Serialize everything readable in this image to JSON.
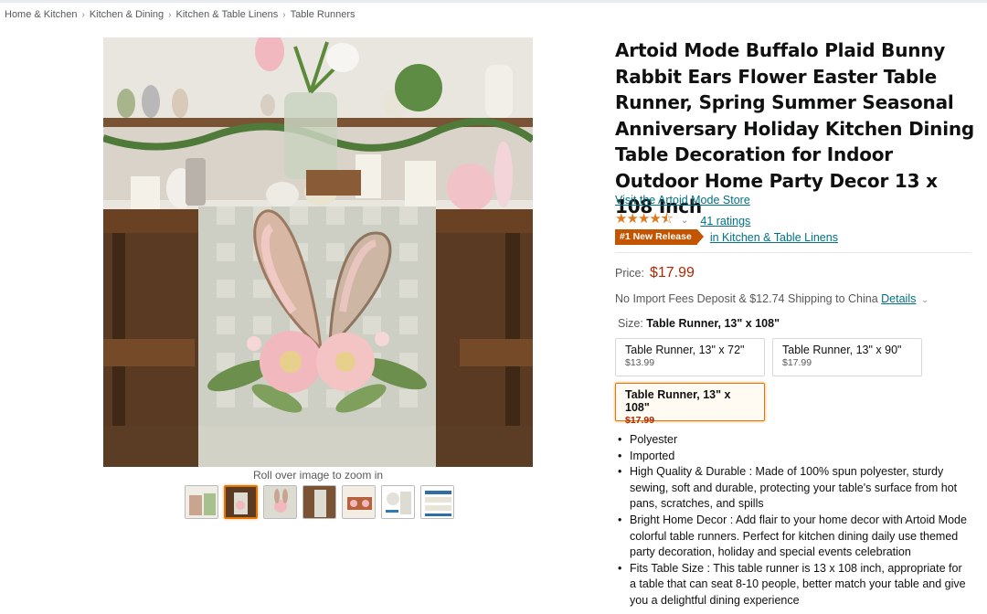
{
  "breadcrumb": [
    "Home & Kitchen",
    "Kitchen & Dining",
    "Kitchen & Table Linens",
    "Table Runners"
  ],
  "breadcrumb_separator": "›",
  "gallery": {
    "zoom_hint": "Roll over image to zoom in",
    "thumbnail_count": 7,
    "active_thumbnail": 2
  },
  "product": {
    "title": "Artoid Mode Buffalo Plaid Bunny Rabbit Ears Flower Easter Table Runner, Spring Summer Seasonal Anniversary Holiday Kitchen Dining Table Decoration for Indoor Outdoor Home Party Decor 13 x 108 Inch",
    "store_link": "Visit the Artoid Mode Store",
    "rating_stars": "★★★★⯪",
    "rating_value": 4.5,
    "ratings_count": "41 ratings",
    "badge": "#1 New Release",
    "badge_category": "in Kitchen & Table Linens",
    "price_label": "Price:",
    "price": "$17.99",
    "shipping_text": "No Import Fees Deposit & $12.74 Shipping to China",
    "shipping_details": "Details"
  },
  "size": {
    "label": "Size:",
    "selected": "Table Runner, 13\" x 108\"",
    "options": [
      {
        "name": "Table Runner, 13\" x 72\"",
        "price": "$13.99"
      },
      {
        "name": "Table Runner, 13\" x 90\"",
        "price": "$17.99"
      },
      {
        "name": "Table Runner, 13\" x 108\"",
        "price": "$17.99"
      }
    ]
  },
  "bullets": [
    "Polyester",
    "Imported",
    "High Quality & Durable : Made of 100% spun polyester, sturdy sewing, soft and durable, protecting your table's surface from hot pans, scratches, and spills",
    "Bright Home Decor : Add flair to your home decor with Artoid Mode colorful table runners. Perfect for kitchen dining daily use themed party decoration, holiday and special events celebration",
    "Fits Table Size : This table runner is 13 x 108 inch, appropriate for a table that can seat 8-10 people, better match your table and give you a delightful dining experience"
  ],
  "colors": {
    "link": "#007185",
    "price": "#b12704",
    "badge": "#c45500",
    "star": "#de7921",
    "selected_border": "#e77600"
  },
  "icons": [
    "chevron-down-icon",
    "star-icon"
  ]
}
